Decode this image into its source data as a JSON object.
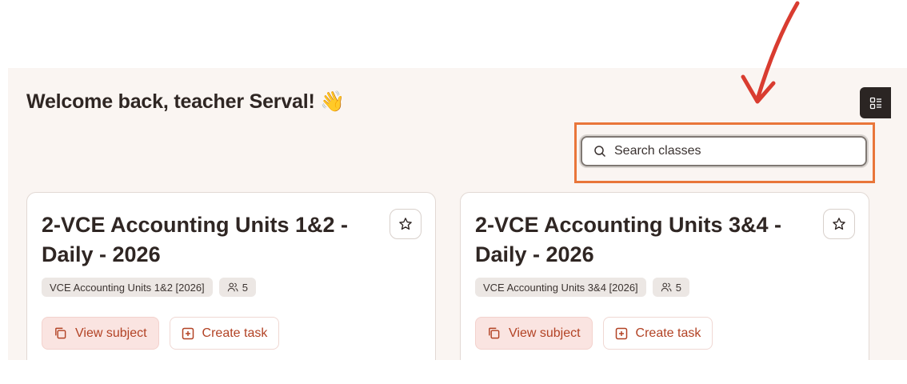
{
  "header": {
    "welcome_text": "Welcome back, teacher Serval!",
    "wave_emoji": "👋"
  },
  "search": {
    "placeholder": "Search classes"
  },
  "icons": {
    "search": "search-icon",
    "layout_toggle": "list-layout-icon",
    "star": "star-icon",
    "users": "users-icon",
    "view_subject": "copy-icon",
    "create_task": "plus-square-icon"
  },
  "classes": [
    {
      "title": "2-VCE Accounting Units 1&2 - Daily - 2026",
      "subject_tag": "VCE Accounting Units 1&2 [2026]",
      "student_count": "5",
      "view_label": "View subject",
      "create_label": "Create task"
    },
    {
      "title": "2-VCE Accounting Units 3&4 - Daily - 2026",
      "subject_tag": "VCE Accounting Units 3&4 [2026]",
      "student_count": "5",
      "view_label": "View subject",
      "create_label": "Create task"
    }
  ],
  "colors": {
    "background": "#faf5f2",
    "accent_text": "#b24224",
    "highlight_box": "#e9763a",
    "annotation_arrow": "#d93c30"
  }
}
